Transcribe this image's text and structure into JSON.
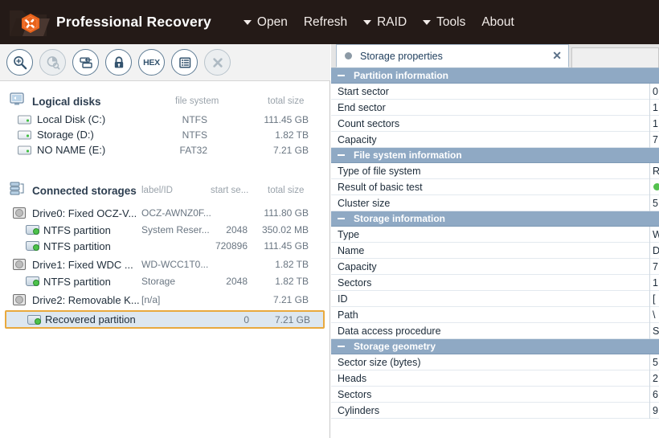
{
  "titlebar": {
    "app_title": "Professional Recovery",
    "logo_icon": "folder-hexagon-tools-logo",
    "menu": [
      {
        "label": "Open",
        "has_caret": true,
        "icon": "chevron-down-icon"
      },
      {
        "label": "Refresh",
        "has_caret": false,
        "icon": ""
      },
      {
        "label": "RAID",
        "has_caret": true,
        "icon": "chevron-down-icon"
      },
      {
        "label": "Tools",
        "has_caret": true,
        "icon": "chevron-down-icon"
      },
      {
        "label": "About",
        "has_caret": false,
        "icon": ""
      }
    ]
  },
  "toolbar": {
    "buttons": [
      {
        "name": "magnifier-icon",
        "glyph": "",
        "disabled": false
      },
      {
        "name": "disk-chart-icon",
        "glyph": "",
        "disabled": true
      },
      {
        "name": "disk-copy-icon",
        "glyph": "",
        "disabled": false
      },
      {
        "name": "lock-icon",
        "glyph": "",
        "disabled": false
      },
      {
        "name": "hex-icon",
        "glyph": "HEX",
        "disabled": false
      },
      {
        "name": "list-icon",
        "glyph": "",
        "disabled": false
      },
      {
        "name": "close-icon",
        "glyph": "",
        "disabled": true
      }
    ]
  },
  "logical_disks": {
    "title": "Logical disks",
    "icon": "computer-monitor-icon",
    "columns": {
      "file_system": "file system",
      "total_size": "total size"
    },
    "rows": [
      {
        "icon": "disk-icon",
        "name": "Local Disk (C:)",
        "file_system": "NTFS",
        "total_size": "111.45 GB"
      },
      {
        "icon": "disk-icon",
        "name": "Storage (D:)",
        "file_system": "NTFS",
        "total_size": "1.82 TB"
      },
      {
        "icon": "disk-icon",
        "name": "NO NAME (E:)",
        "file_system": "FAT32",
        "total_size": "7.21 GB"
      }
    ]
  },
  "connected_storages": {
    "title": "Connected storages",
    "icon": "stacked-disks-icon",
    "columns": {
      "label_id": "label/ID",
      "start_sector": "start se...",
      "total_size": "total size"
    },
    "rows": [
      {
        "icon": "drive-icon",
        "indent": 0,
        "name": "Drive0: Fixed OCZ-V...",
        "label_id": "OCZ-AWNZ0F...",
        "start_sector": "",
        "total_size": "111.80 GB",
        "selected": false
      },
      {
        "icon": "partition-icon",
        "indent": 1,
        "name": "NTFS partition",
        "label_id": "System Reser...",
        "start_sector": "2048",
        "total_size": "350.02 MB",
        "selected": false
      },
      {
        "icon": "partition-icon",
        "indent": 1,
        "name": "NTFS partition",
        "label_id": "",
        "start_sector": "720896",
        "total_size": "111.45 GB",
        "selected": false
      },
      {
        "icon": "drive-icon",
        "indent": 0,
        "name": "Drive1: Fixed WDC ...",
        "label_id": "WD-WCC1T0...",
        "start_sector": "",
        "total_size": "1.82 TB",
        "selected": false
      },
      {
        "icon": "partition-icon",
        "indent": 1,
        "name": "NTFS partition",
        "label_id": "Storage",
        "start_sector": "2048",
        "total_size": "1.82 TB",
        "selected": false
      },
      {
        "icon": "drive-icon",
        "indent": 0,
        "name": "Drive2: Removable K...",
        "label_id": "[n/a]",
        "start_sector": "",
        "total_size": "7.21 GB",
        "selected": false
      },
      {
        "icon": "partition-icon",
        "indent": 1,
        "name": "Recovered partition",
        "label_id": "",
        "start_sector": "0",
        "total_size": "7.21 GB",
        "selected": true
      }
    ]
  },
  "properties_panel": {
    "tab": {
      "label": "Storage properties",
      "dot_icon": "bullet-dot-icon",
      "close_icon": "close-icon",
      "close_label": "✕"
    },
    "sections": [
      {
        "title": "Partition information",
        "collapse_icon": "minus-icon",
        "rows": [
          {
            "key": "Start sector",
            "value": "0",
            "is_dot": false
          },
          {
            "key": "End sector",
            "value": "1",
            "is_dot": false
          },
          {
            "key": "Count sectors",
            "value": "1",
            "is_dot": false
          },
          {
            "key": "Capacity",
            "value": "7",
            "is_dot": false
          }
        ]
      },
      {
        "title": "File system information",
        "collapse_icon": "minus-icon",
        "rows": [
          {
            "key": "Type of file system",
            "value": "R",
            "is_dot": false
          },
          {
            "key": "Result of basic test",
            "value": "",
            "is_dot": true
          },
          {
            "key": "Cluster size",
            "value": "5",
            "is_dot": false
          }
        ]
      },
      {
        "title": "Storage information",
        "collapse_icon": "minus-icon",
        "rows": [
          {
            "key": "Type",
            "value": "W",
            "is_dot": false
          },
          {
            "key": "Name",
            "value": "D",
            "is_dot": false
          },
          {
            "key": "Capacity",
            "value": "7",
            "is_dot": false
          },
          {
            "key": "Sectors",
            "value": "1",
            "is_dot": false
          },
          {
            "key": "ID",
            "value": "[",
            "is_dot": false
          },
          {
            "key": "Path",
            "value": "\\",
            "is_dot": false
          },
          {
            "key": "Data access procedure",
            "value": "S",
            "is_dot": false
          }
        ]
      },
      {
        "title": "Storage geometry",
        "collapse_icon": "minus-icon",
        "rows": [
          {
            "key": "Sector size (bytes)",
            "value": "5",
            "is_dot": false
          },
          {
            "key": "Heads",
            "value": "2",
            "is_dot": false
          },
          {
            "key": "Sectors",
            "value": "6",
            "is_dot": false
          },
          {
            "key": "Cylinders",
            "value": "9",
            "is_dot": false
          }
        ]
      }
    ]
  },
  "colors": {
    "titlebar_bg": "#241a17",
    "logo_accent": "#e8621a",
    "section_header": "#8fa9c4",
    "selection_border": "#e9a93e",
    "selection_fill": "#dde7f0",
    "icon_blue": "#33536e",
    "status_green": "#55c24f"
  }
}
